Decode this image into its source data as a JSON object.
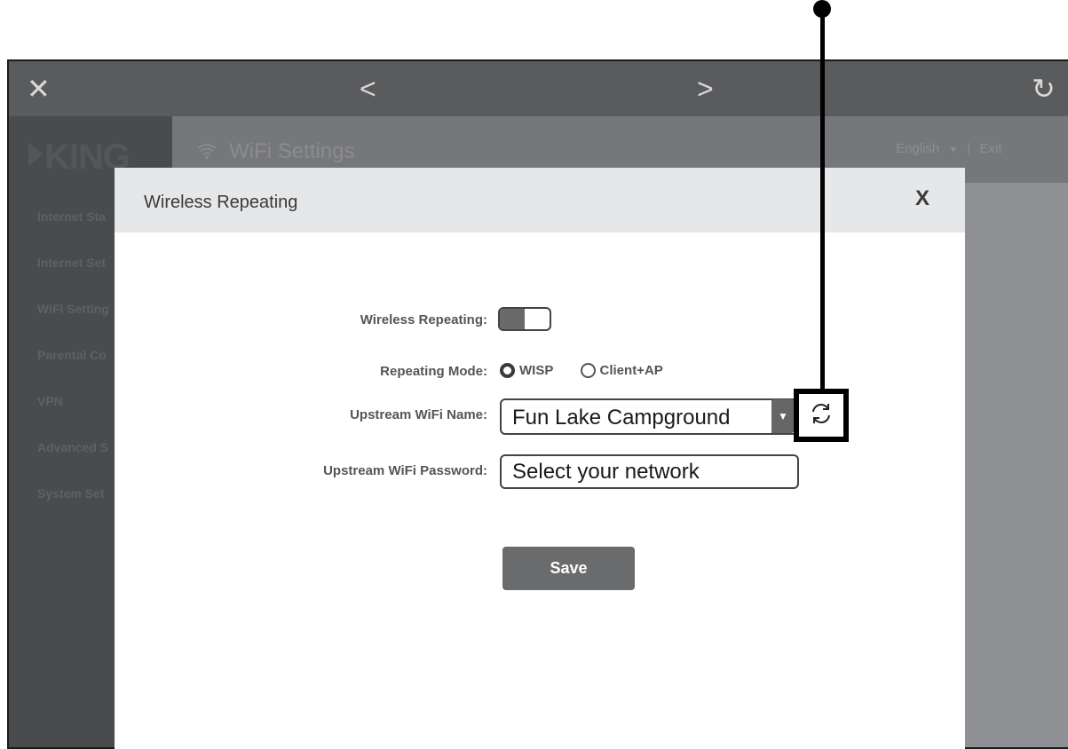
{
  "topbar": {
    "close_icon": "✕",
    "back_icon": "<",
    "forward_icon": ">",
    "refresh_icon": "↻"
  },
  "brand": {
    "logo_text": "KING"
  },
  "sidebar": {
    "items": [
      {
        "label": "Internet Sta"
      },
      {
        "label": "Internet Set"
      },
      {
        "label": "WiFi Setting"
      },
      {
        "label": "Parental Co"
      },
      {
        "label": "VPN"
      },
      {
        "label": "Advanced S"
      },
      {
        "label": "System Set"
      }
    ]
  },
  "header": {
    "title": "WiFi Settings",
    "language": "English",
    "language_caret": "▼",
    "separator": "|",
    "exit_label": "Exit"
  },
  "modal": {
    "title": "Wireless Repeating",
    "close_label": "X",
    "wireless_repeating_label": "Wireless Repeating:",
    "wireless_repeating_enabled": true,
    "repeating_mode_label": "Repeating Mode:",
    "mode_options": [
      {
        "label": "WISP",
        "selected": true
      },
      {
        "label": "Client+AP",
        "selected": false
      }
    ],
    "upstream_name_label": "Upstream WiFi Name:",
    "upstream_name_value": "Fun Lake Campground",
    "upstream_password_label": "Upstream WiFi Password:",
    "upstream_password_placeholder": "Select your network",
    "save_label": "Save"
  },
  "colors": {
    "sidebar_bg": "#4a4b4d",
    "topbar_bg": "#5a5b5d",
    "button_bg": "#6a6b6d",
    "modal_header_bg": "#e6e7e8"
  }
}
